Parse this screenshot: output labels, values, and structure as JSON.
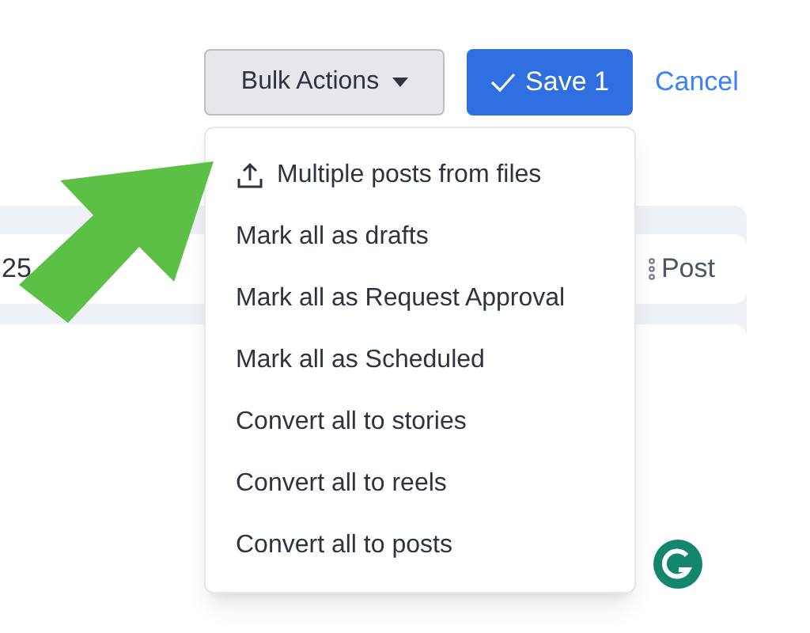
{
  "toolbar": {
    "bulk_actions": {
      "label": "Bulk Actions",
      "expanded": true
    },
    "save": {
      "label": "Save",
      "count": "1"
    },
    "cancel": "Cancel"
  },
  "menu": [
    {
      "label": "Multiple posts from files",
      "kind": "upload"
    },
    {
      "label": "Mark all as drafts",
      "kind": "plain"
    },
    {
      "label": "Mark all as Request Approval",
      "kind": "plain"
    },
    {
      "label": "Mark all as Scheduled",
      "kind": "plain"
    },
    {
      "label": "Convert all to stories",
      "kind": "plain"
    },
    {
      "label": "Convert all to reels",
      "kind": "plain"
    },
    {
      "label": "Convert all to posts",
      "kind": "plain"
    }
  ],
  "post_row": {
    "date_fragment": "25",
    "type_label": "Post"
  }
}
